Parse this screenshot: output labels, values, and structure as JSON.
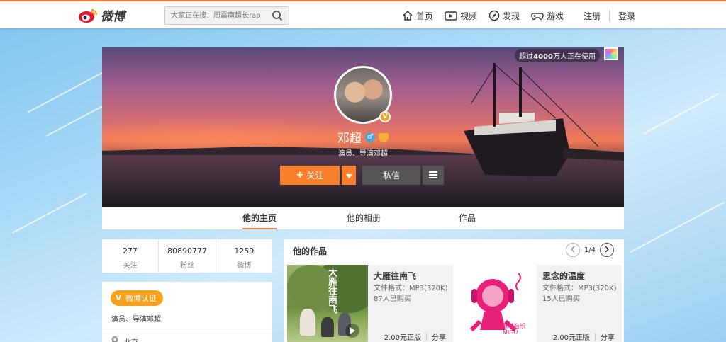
{
  "topbar": {
    "logo_text": "微博",
    "search_placeholder": "大家正在搜：周震南超长rap",
    "nav": [
      {
        "icon": "home-icon",
        "label": "首页"
      },
      {
        "icon": "video-icon",
        "label": "视频"
      },
      {
        "icon": "compass-icon",
        "label": "发现"
      },
      {
        "icon": "gamepad-icon",
        "label": "游戏"
      }
    ],
    "register": "注册",
    "login": "登录"
  },
  "cover": {
    "online_prefix": "超过",
    "online_count": "4000",
    "online_suffix": "万人正在使用",
    "username": "邓超",
    "gender_symbol": "♂",
    "description": "演员、导演邓超",
    "verified_mark": "V",
    "follow_label": "关注",
    "message_label": "私信"
  },
  "tabs": [
    "他的主页",
    "他的相册",
    "作品"
  ],
  "stats": [
    {
      "value": "277",
      "label": "关注"
    },
    {
      "value": "80890777",
      "label": "粉丝"
    },
    {
      "value": "1259",
      "label": "微博"
    }
  ],
  "verify": {
    "badge": "微博认证",
    "badge_mark": "V",
    "description": "演员、导演邓超",
    "location": "北京"
  },
  "works": {
    "title": "他的作品",
    "page": "1/4",
    "items": [
      {
        "title": "大雁往南飞",
        "format": "文件格式：MP3(320K)",
        "bought": "87人已购买",
        "price": "2.00元正版",
        "share": "分享",
        "cover_text": "大雁往南飞"
      },
      {
        "title": "思念的温度",
        "format": "文件格式：MP3(320K)",
        "bought": "15人已购买",
        "price": "2.00元正版",
        "share": "分享",
        "cover_text": "咪咕音乐 MIGU"
      }
    ]
  },
  "colors": {
    "accent": "#fa7d3c",
    "follow_button": "#f97f2b",
    "verified": "#f7a21a"
  }
}
